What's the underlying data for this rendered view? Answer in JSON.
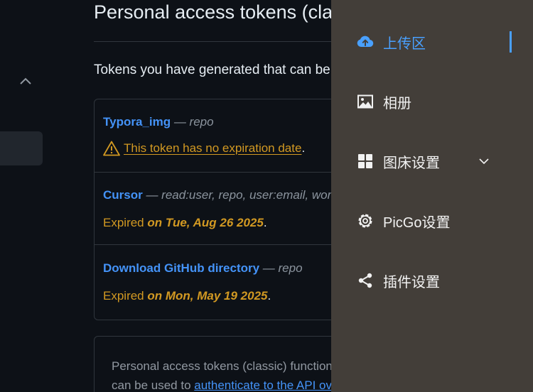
{
  "github": {
    "page_title": "Personal access tokens (classic)",
    "subtitle": "Tokens you have generated that can be used to access the GitHub API.",
    "tokens": [
      {
        "name": "Typora_img",
        "scopes": " — repo",
        "warning": "This token has no expiration date",
        "warning_end": "."
      },
      {
        "name": "Cursor",
        "scopes": " — read:user, repo, user:email, workflow",
        "status_prefix": "Expired ",
        "status_date": "on Tue, Aug 26 2025",
        "status_end": "."
      },
      {
        "name": "Download GitHub directory",
        "scopes": " — repo",
        "status_prefix": "Expired ",
        "status_date": "on Mon, May 19 2025",
        "status_end": "."
      }
    ],
    "info_line1": "Personal access tokens (classic) function like ordinary OAuth access tokens. They",
    "info_line2_prefix": "can be used to ",
    "info_link": "authenticate to the API over Basic Authentication"
  },
  "picgo_menu": {
    "items": [
      {
        "label": "上传区",
        "icon": "cloud-upload-icon",
        "active": true
      },
      {
        "label": "相册",
        "icon": "image-icon"
      },
      {
        "label": "图床设置",
        "icon": "grid-icon",
        "expandable": true
      },
      {
        "label": "PicGo设置",
        "icon": "gear-icon"
      },
      {
        "label": "插件设置",
        "icon": "share-icon"
      }
    ]
  },
  "colors": {
    "menu_bg": "#433e39",
    "accent": "#49a0ff",
    "github_bg": "#0d1117",
    "link": "#4493f8",
    "warning": "#d29922"
  }
}
